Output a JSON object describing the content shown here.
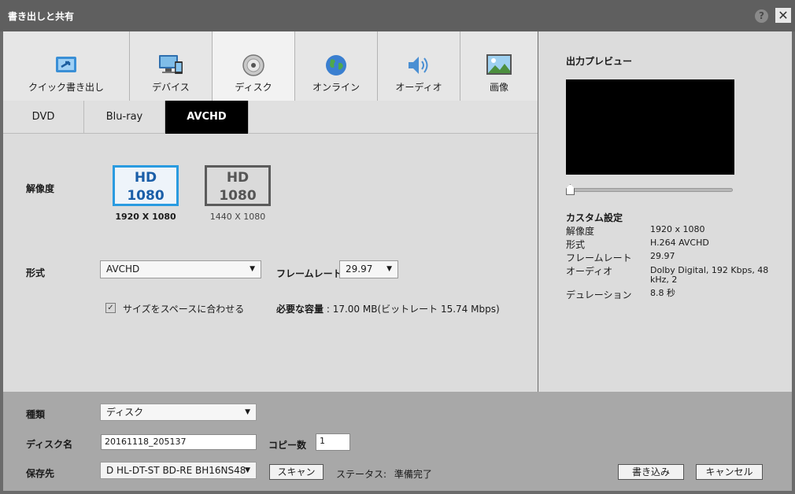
{
  "window": {
    "title": "書き出しと共有"
  },
  "categories": [
    {
      "label": "クイック書き出し",
      "icon": "quick-export-icon"
    },
    {
      "label": "デバイス",
      "icon": "device-icon"
    },
    {
      "label": "ディスク",
      "icon": "disc-icon"
    },
    {
      "label": "オンライン",
      "icon": "globe-icon"
    },
    {
      "label": "オーディオ",
      "icon": "speaker-icon"
    },
    {
      "label": "画像",
      "icon": "image-icon"
    }
  ],
  "selected_category": "ディスク",
  "subtabs": [
    "DVD",
    "Blu-ray",
    "AVCHD"
  ],
  "active_subtab": "AVCHD",
  "settings": {
    "resolution_label": "解像度",
    "resolution_options": [
      {
        "line1": "HD",
        "line2": "1080",
        "caption": "1920 X 1080",
        "selected": true
      },
      {
        "line1": "HD",
        "line2": "1080",
        "caption": "1440 X 1080",
        "selected": false
      }
    ],
    "format_label": "形式",
    "format_value": "AVCHD",
    "framerate_label": "フレームレート",
    "framerate_value": "29.97",
    "fit_label": "サイズをスペースに合わせる",
    "fit_checked": true,
    "required_label": "必要な容量",
    "required_value": ": 17.00 MB(ビットレート 15.74 Mbps)"
  },
  "preview": {
    "title": "出力プレビュー",
    "custom_title": "カスタム設定",
    "rows": [
      {
        "key": "解像度",
        "value": "1920 x 1080"
      },
      {
        "key": "形式",
        "value": "H.264 AVCHD"
      },
      {
        "key": "フレームレート",
        "value": "29.97"
      },
      {
        "key": "オーディオ",
        "value": "Dolby Digital, 192 Kbps, 48 kHz, 2"
      },
      {
        "key": "デュレーション",
        "value": "8.8 秒"
      }
    ]
  },
  "bottom": {
    "type_label": "種類",
    "type_value": "ディスク",
    "disc_name_label": "ディスク名",
    "disc_name_value": "20161118_205137",
    "copies_label": "コピー数",
    "copies_value": "1",
    "dest_label": "保存先",
    "dest_value": "D HL-DT-ST BD-RE  BH16NS48",
    "scan_label": "スキャン",
    "status_label": "ステータス:",
    "status_value": "準備完了",
    "write_label": "書き込み",
    "cancel_label": "キャンセル"
  },
  "colors": {
    "accent": "#2a9be0",
    "selected_tab": "#000000"
  }
}
